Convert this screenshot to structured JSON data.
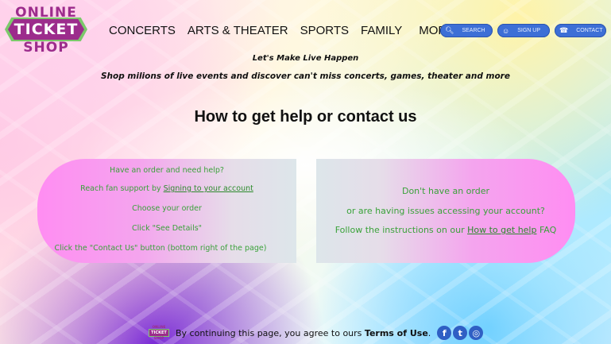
{
  "logo": {
    "line1": "ONLINE",
    "line2": "TICKET",
    "line3": "SHOP"
  },
  "nav": [
    "CONCERTS",
    "ARTS & THEATER",
    "SPORTS",
    "FAMILY",
    "MORE"
  ],
  "header_buttons": {
    "search": {
      "label": "SEARCH",
      "icon": "search-icon"
    },
    "signup": {
      "label": "SIGN UP",
      "icon": "user-add-icon"
    },
    "contact": {
      "label": "CONTACT",
      "icon": "phone-icon"
    }
  },
  "tagline": {
    "line1": "Let's Make Live Happen",
    "line2": "Shop milions of live events and discover can't miss concerts, games, theater and more"
  },
  "page_title": "How to get help or contact us",
  "left_card": {
    "line1": "Have an order and need help?",
    "line2_prefix": "Reach fan support by ",
    "line2_link": "Signing to your account",
    "line3": "Choose your order",
    "line4": "Click \"See Details\"",
    "line5": "Click the \"Contact Us\" button (bottom right of the page)"
  },
  "right_card": {
    "line1": "Don't have an order",
    "line2": "or are having issues accessing your account?",
    "line3_prefix": "Follow the instructions on our ",
    "line3_link": "How to get help",
    "line3_suffix": " FAQ"
  },
  "footer": {
    "mini_logo": {
      "line1": "ONLINE",
      "line2": "TICKET",
      "line3": "SHOP"
    },
    "text_prefix": "By continuing this page, you agree to ours ",
    "terms_link": "Terms of Use",
    "text_suffix": ".",
    "socials": [
      {
        "name": "facebook",
        "glyph": "f"
      },
      {
        "name": "twitter",
        "glyph": "t"
      },
      {
        "name": "instagram",
        "glyph": "◎"
      }
    ]
  },
  "colors": {
    "accent": "#9c2c8c",
    "green_text": "#3aa23a",
    "button_blue": "#3d6fd6"
  }
}
